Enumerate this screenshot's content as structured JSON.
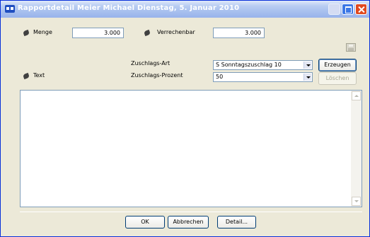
{
  "window": {
    "title": "Rapportdetail Meier Michael Dienstag, 5. Januar 2010"
  },
  "form": {
    "menge_label": "Menge",
    "menge_value": "3.000",
    "verrechenbar_label": "Verrechenbar",
    "verrechenbar_value": "3.000",
    "zuschlags_art_label": "Zuschlags-Art",
    "zuschlags_art_value": "S Sonntagszuschlag 10",
    "zuschlags_prozent_label": "Zuschlags-Prozent",
    "zuschlags_prozent_value": "50",
    "text_label": "Text",
    "text_value": ""
  },
  "buttons": {
    "erzeugen": "Erzeugen",
    "loeschen": "Löschen",
    "ok": "OK",
    "abbrechen": "Abbrechen",
    "detail": "Detail..."
  },
  "colors": {
    "title_gradient_start": "#dfe8fa",
    "window_border": "#0831d9",
    "dialog_background": "#ece9d8"
  },
  "icons": {
    "app": "app-icon",
    "menge": "leaf-icon",
    "verrechenbar": "leaf-icon",
    "text": "leaf-icon",
    "save": "save-icon"
  }
}
